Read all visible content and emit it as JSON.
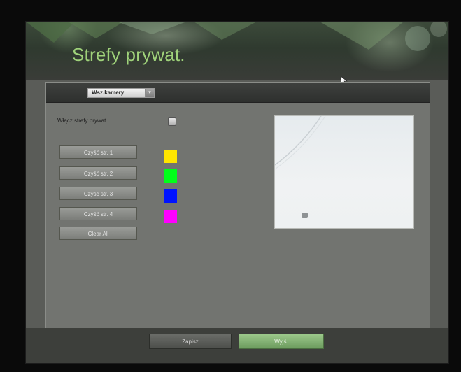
{
  "header": {
    "title": "Strefy prywat."
  },
  "toolbar": {
    "camera_select": {
      "value": "Wsz.kamery",
      "arrow_icon": "chevron-down-icon"
    }
  },
  "settings": {
    "enable_label": "Włącz strefy prywat.",
    "enable_checked": false
  },
  "zones": [
    {
      "label": "Czyść str. 1",
      "color": "#ffe600"
    },
    {
      "label": "Czyść str. 2",
      "color": "#00ff19"
    },
    {
      "label": "Czyść str. 3",
      "color": "#0013ff"
    },
    {
      "label": "Czyść str. 4",
      "color": "#ff00ff"
    }
  ],
  "clear_all_label": "Clear All",
  "preview": {
    "icon": "camera-icon"
  },
  "footer": {
    "save_label": "Zapisz",
    "exit_label": "Wyjś."
  },
  "colors": {
    "title": "#9fd27a",
    "panel": "#727470",
    "exit_accent": "#8ab87a"
  }
}
